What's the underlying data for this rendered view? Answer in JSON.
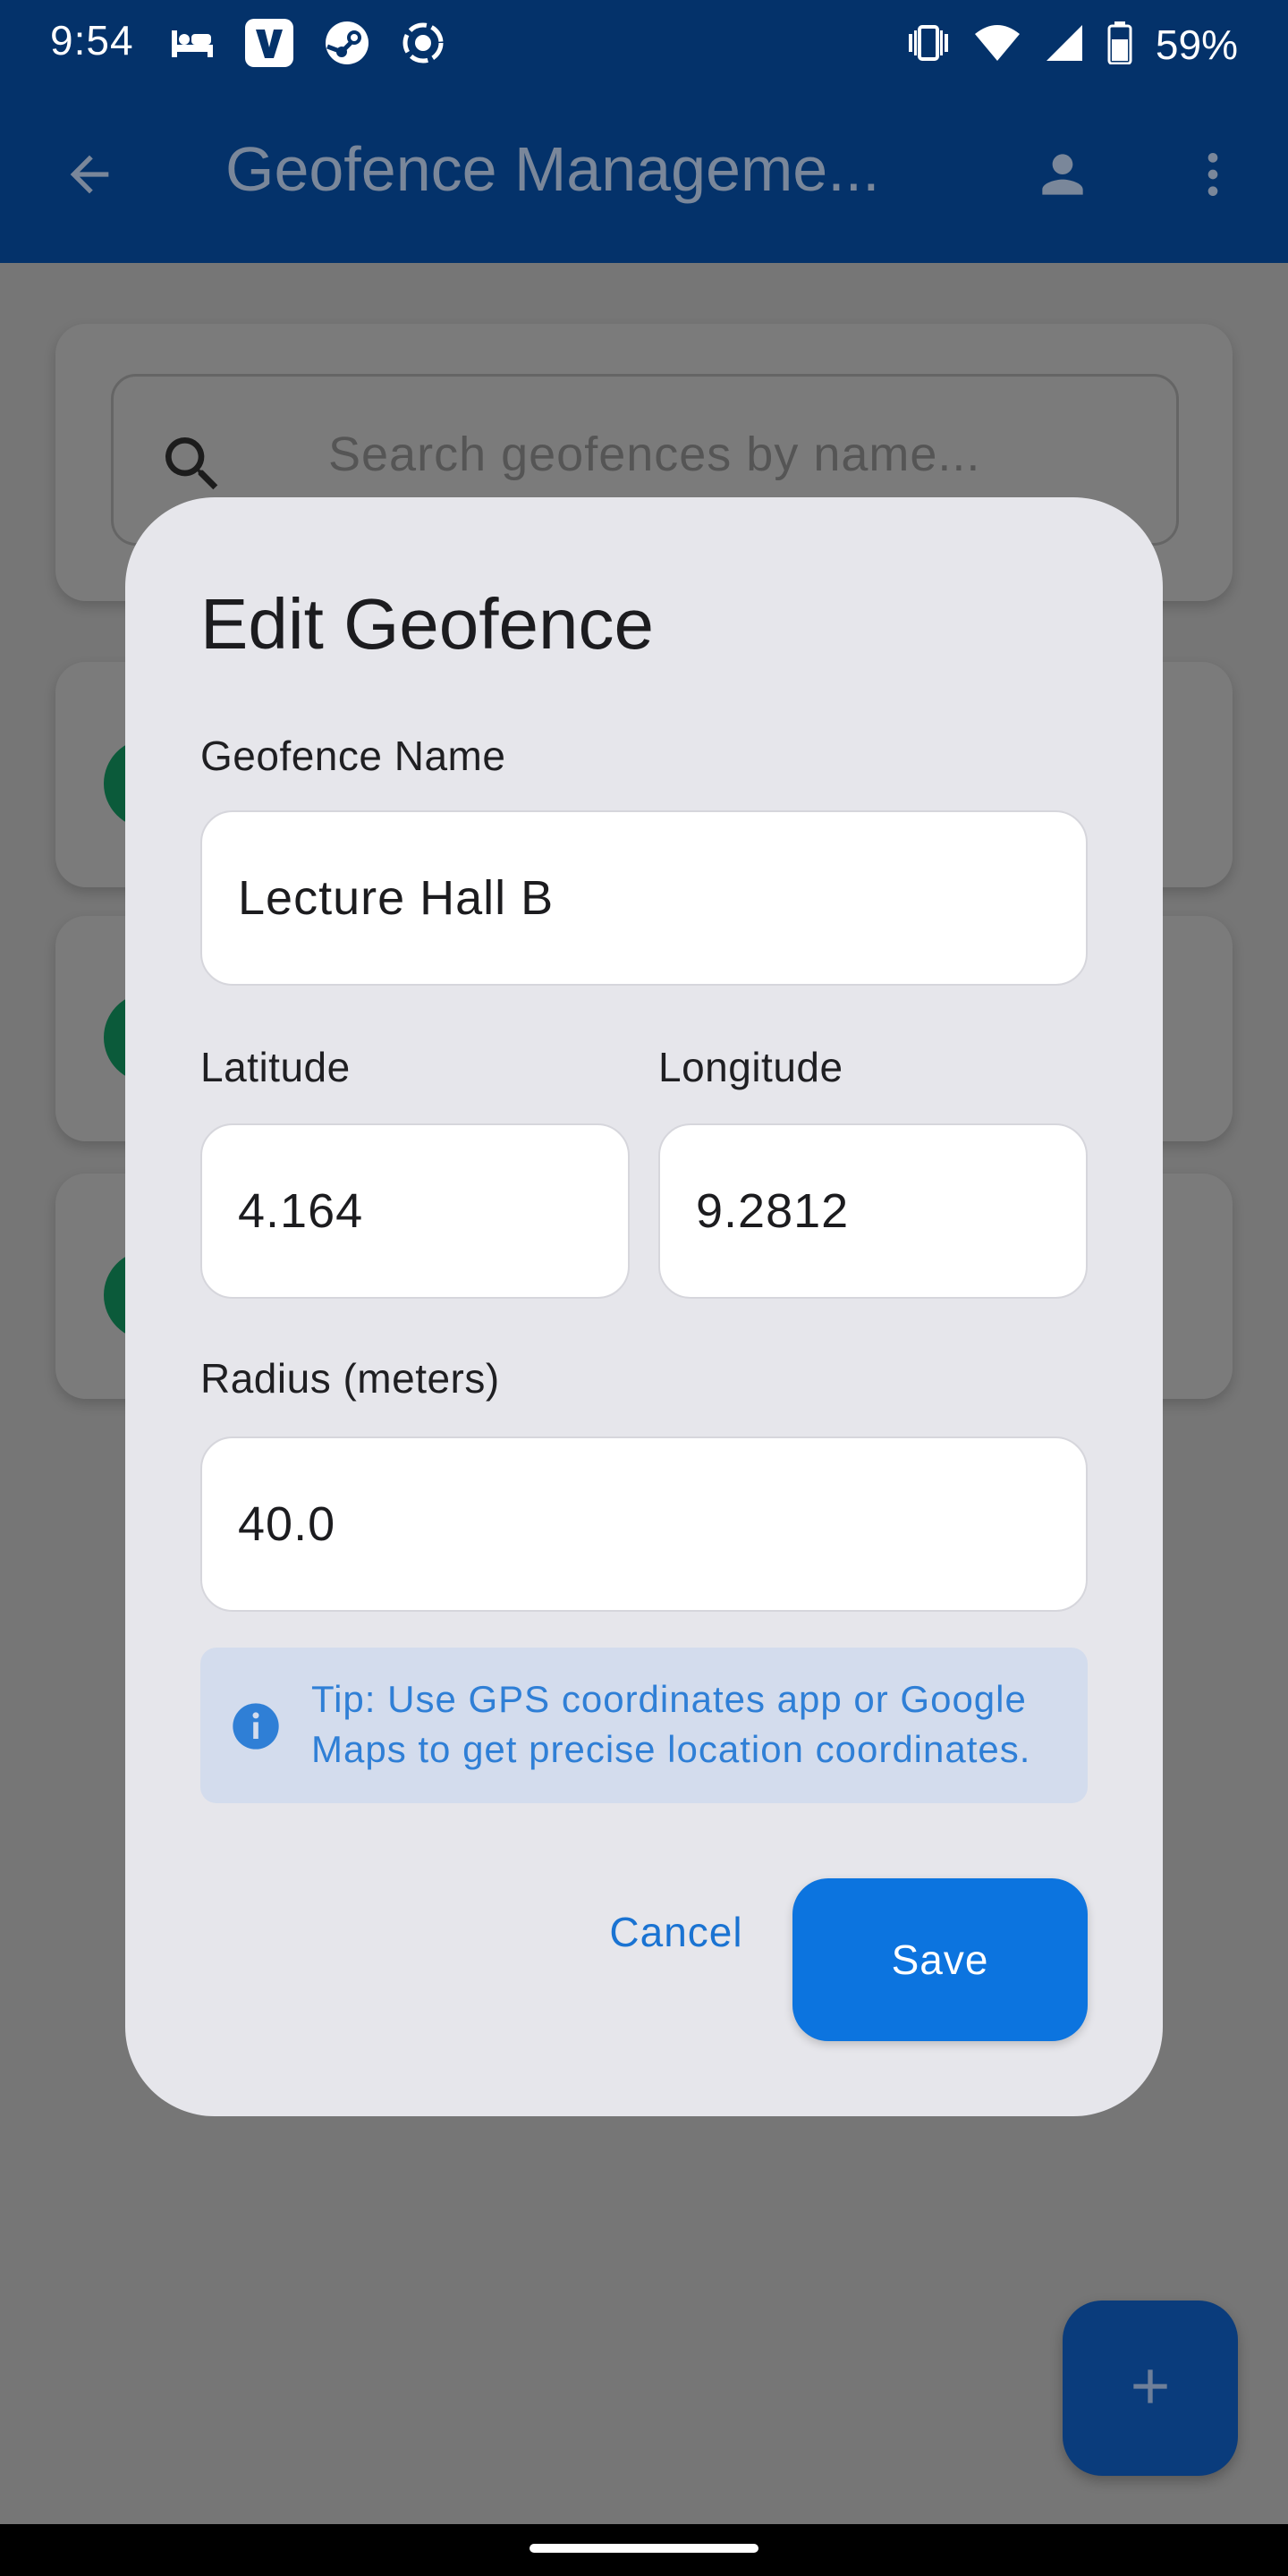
{
  "status_bar": {
    "time": "9:54",
    "battery": "59%",
    "icons": [
      "bed-icon",
      "v-app-icon",
      "steam-icon",
      "record-icon",
      "vibrate-icon",
      "wifi-icon",
      "signal-icon",
      "battery-icon"
    ]
  },
  "app_bar": {
    "title": "Geofence Manageme...",
    "back_icon": "arrow-back-icon",
    "account_icon": "account-icon",
    "more_icon": "more-vert-icon"
  },
  "search": {
    "placeholder": "Search geofences by name..."
  },
  "dialog": {
    "title": "Edit Geofence",
    "name_label": "Geofence Name",
    "name_value": "Lecture Hall B",
    "latitude_label": "Latitude",
    "latitude_value": "4.164",
    "longitude_label": "Longitude",
    "longitude_value": "9.2812",
    "radius_label": "Radius (meters)",
    "radius_value": "40.0",
    "tip": "Tip: Use GPS coordinates app or Google Maps to get precise location coordinates.",
    "cancel_label": "Cancel",
    "save_label": "Save"
  },
  "fab": {
    "icon": "plus-icon"
  },
  "colors": {
    "app_bar": "#04326a",
    "primary": "#0c74df",
    "scrim": "#767676",
    "dialog_bg": "#e6e6eb",
    "tip_bg": "#d3dced",
    "tip_text": "#2f7fd6"
  }
}
